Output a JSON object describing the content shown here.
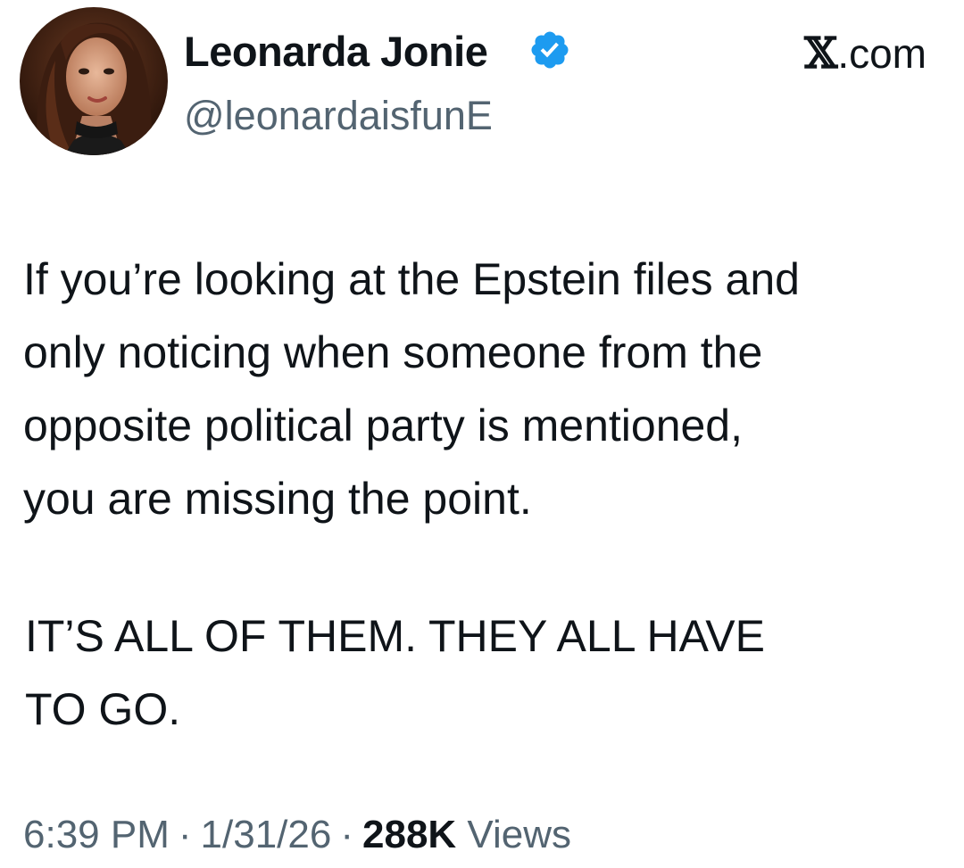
{
  "author": {
    "display_name": "Leonarda Jonie",
    "handle": "@leonardaisfunE",
    "verified_icon": "verified-badge-icon",
    "verified_color": "#1d9bf0"
  },
  "brand": {
    "glyph": "𝕏",
    "suffix": ".com"
  },
  "tweet": {
    "lines": [
      "If you’re looking at the Epstein files and",
      "only noticing when someone from the",
      "opposite political party is mentioned,",
      "you are missing the point."
    ],
    "shout_lines": [
      "IT’S ALL OF THEM. THEY ALL HAVE",
      "TO GO."
    ]
  },
  "meta": {
    "time": "6:39 PM",
    "date": "1/31/26",
    "separator": "·",
    "views_count": "288K",
    "views_label": "Views"
  },
  "colors": {
    "text_primary": "#0f1419",
    "text_secondary": "#536471"
  }
}
